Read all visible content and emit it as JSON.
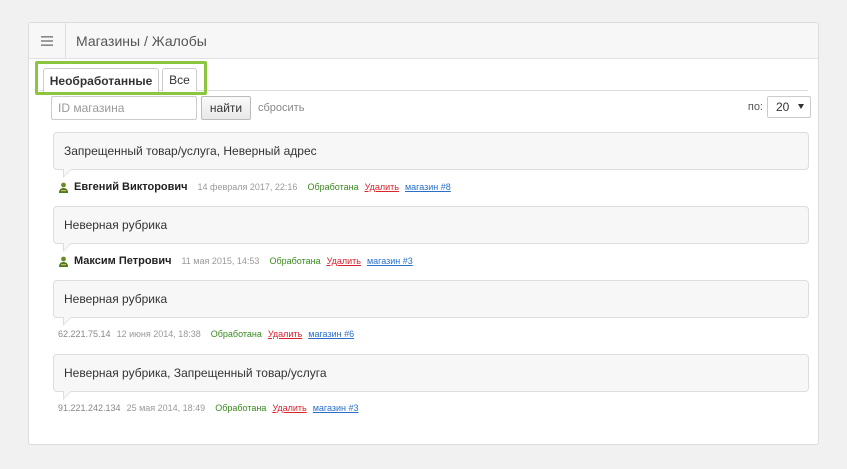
{
  "header": {
    "breadcrumb": "Магазины / Жалобы",
    "menu_icon": "hamburger-icon"
  },
  "tabs": [
    {
      "label": "Необработанные",
      "active": true
    },
    {
      "label": "Все",
      "active": false
    }
  ],
  "filter": {
    "shop_id_placeholder": "ID магазина",
    "shop_id_value": "",
    "find_label": "найти",
    "reset_label": "сбросить",
    "per_page_label": "по:",
    "per_page_value": "20"
  },
  "complaints": [
    {
      "text": "Запрещенный товар/услуга, Неверный адрес",
      "author": "Евгений Викторович",
      "ip": "",
      "date": "14 февраля 2017, 22:16",
      "status": "Обработана",
      "delete": "Удалить",
      "shop": "магазин #8"
    },
    {
      "text": "Неверная рубрика",
      "author": "Максим Петрович",
      "ip": "",
      "date": "11 мая 2015, 14:53",
      "status": "Обработана",
      "delete": "Удалить",
      "shop": "магазин #3"
    },
    {
      "text": "Неверная рубрика",
      "author": "",
      "ip": "62.221.75.14",
      "date": "12 июня 2014, 18:38",
      "status": "Обработана",
      "delete": "Удалить",
      "shop": "магазин #6"
    },
    {
      "text": "Неверная рубрика, Запрещенный товар/услуга",
      "author": "",
      "ip": "91.221.242.134",
      "date": "25 мая 2014, 18:49",
      "status": "Обработана",
      "delete": "Удалить",
      "shop": "магазин #3"
    }
  ],
  "colors": {
    "highlight": "#8cc63f",
    "status": "#3a8a1f",
    "delete": "#d9232d",
    "link": "#2a6fc9"
  }
}
